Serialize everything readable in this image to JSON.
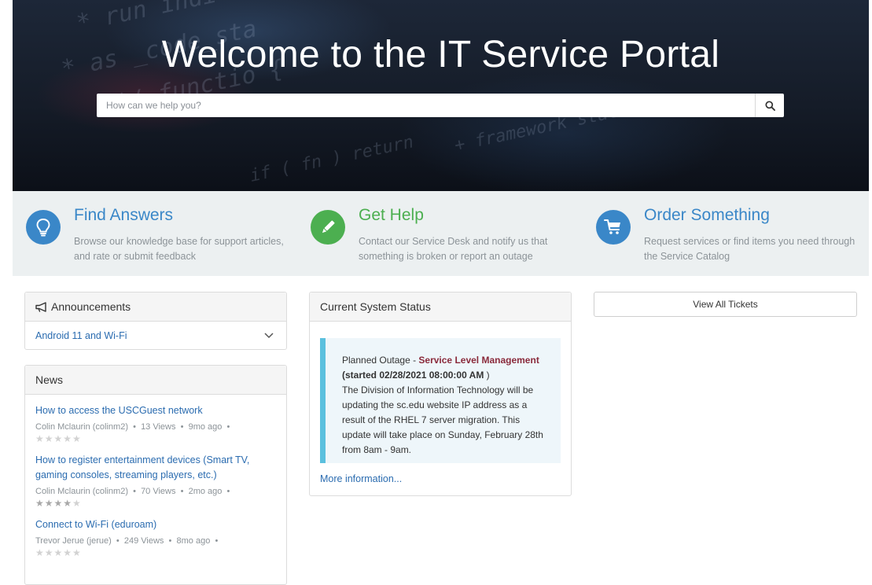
{
  "hero": {
    "title": "Welcome to the IT Service Portal",
    "search_placeholder": "How can we help you?",
    "search_icon": "search-icon"
  },
  "features": [
    {
      "title": "Find Answers",
      "description": "Browse our knowledge base for support articles, and rate or submit feedback",
      "icon": "lightbulb-icon",
      "color": "#3a87c8"
    },
    {
      "title": "Get Help",
      "description": "Contact our Service Desk and notify us that something is broken or report an outage",
      "icon": "pencil-icon",
      "color": "#4caf50"
    },
    {
      "title": "Order Something",
      "description": "Request services or find items you need through the Service Catalog",
      "icon": "cart-icon",
      "color": "#3a87c8"
    }
  ],
  "announcements": {
    "title": "Announcements",
    "icon": "bullhorn-icon",
    "item": "Android 11 and Wi-Fi",
    "expand_icon": "chevron-down-icon"
  },
  "news": {
    "title": "News",
    "items": [
      {
        "title": "How to access the USCGuest network",
        "author": "Colin Mclaurin (colinm2)",
        "views": "13 Views",
        "age": "9mo ago",
        "rating": 0
      },
      {
        "title": "How to register entertainment devices (Smart TV, gaming consoles, streaming players, etc.)",
        "author": "Colin Mclaurin (colinm2)",
        "views": "70 Views",
        "age": "2mo ago",
        "rating": 4
      },
      {
        "title": "Connect to Wi-Fi (eduroam)",
        "author": "Trevor Jerue (jerue)",
        "views": "249 Views",
        "age": "8mo ago",
        "rating": 0
      }
    ]
  },
  "system_status": {
    "title": "Current System Status",
    "prefix": "Planned Outage - ",
    "service": "Service Level Management",
    "started": "(started 02/28/2021 08:00:00 AM",
    "started_close": " )",
    "body": "The Division of Information Technology will be updating the sc.edu website IP address as a result of the RHEL 7 server migration. This update will take place on Sunday, February 28th from 8am - 9am.",
    "more_link": "More information..."
  },
  "tickets": {
    "view_all_label": "View All Tickets"
  },
  "colors": {
    "link": "#2b6cb0",
    "feature_title_blue": "#3a87c8",
    "feature_title_green": "#4caf50",
    "status_accent": "#5bc0de",
    "service_name": "#8a2a3b"
  }
}
